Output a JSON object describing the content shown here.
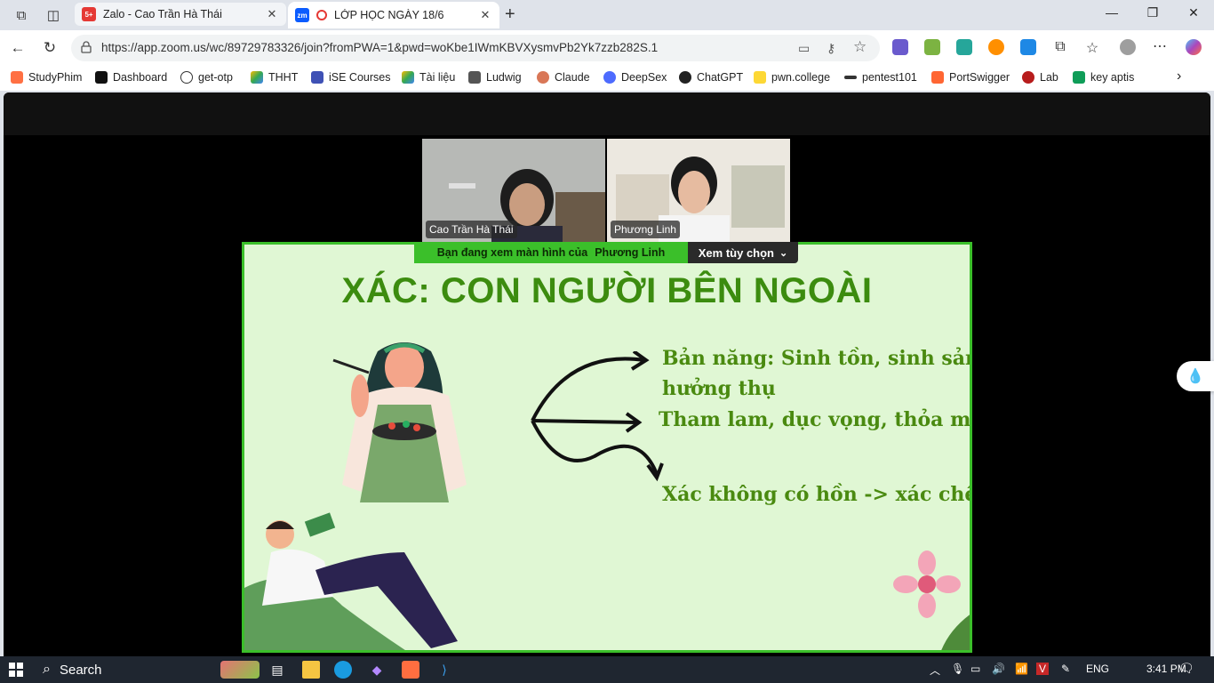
{
  "browser": {
    "tabs": [
      {
        "label": "Zalo - Cao Trần Hà Thái",
        "active": false,
        "favicon_badge": "5+"
      },
      {
        "label": "LỚP HỌC NGÀY 18/6",
        "active": true,
        "favicon_badge": "zm"
      }
    ],
    "url": "https://app.zoom.us/wc/89729783326/join?fromPWA=1&pwd=woKbe1IWmKBVXysmvPb2Yk7zzb282S.1",
    "bookmarks": [
      "StudyPhim",
      "Dashboard",
      "get-otp",
      "THHT",
      "iSE Courses",
      "Tài liệu",
      "Ludwig",
      "Claude",
      "DeepSex",
      "ChatGPT",
      "pwn.college",
      "pentest101",
      "PortSwigger",
      "Lab",
      "key aptis"
    ]
  },
  "zoom": {
    "participants": [
      {
        "name": "Cao Trần Hà Thái"
      },
      {
        "name": "Phương Linh"
      }
    ],
    "share_banner": {
      "prefix": "Bạn đang xem màn hình của",
      "presenter": "Phương Linh"
    },
    "view_options": "Xem tùy chọn"
  },
  "slide": {
    "title": "XÁC: CON NGƯỜI BÊN NGOÀI",
    "lines": [
      "Bản năng: Sinh tồn, sinh sản,",
      "hưởng thụ",
      "Tham lam, dục vọng, thỏa mãn X",
      "Xác không có hồn -> xác chết"
    ]
  },
  "taskbar": {
    "search": "Search",
    "lang": "ENG",
    "time": "3:41 PM"
  },
  "colors": {
    "slide_bg": "#e0f7d4",
    "slide_text": "#4a8a10",
    "accent_green": "#3bbf2a"
  }
}
